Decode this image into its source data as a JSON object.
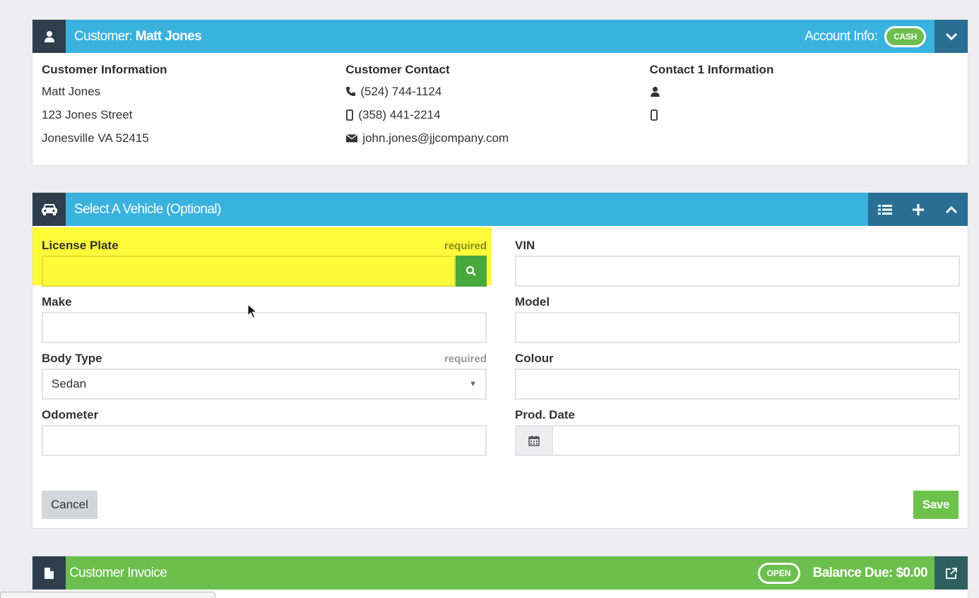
{
  "customer_panel": {
    "title_prefix": "Customer:",
    "customer_name": "Matt Jones",
    "account_info_label": "Account Info:",
    "account_badge": "CASH",
    "columns": {
      "info": {
        "heading": "Customer Information",
        "name": "Matt Jones",
        "street": "123 Jones Street",
        "city_line": "Jonesville VA 52415"
      },
      "contact": {
        "heading": "Customer Contact",
        "phone": "(524) 744-1124",
        "mobile": "(358) 441-2214",
        "email": "john.jones@jjcompany.com"
      },
      "contact1": {
        "heading": "Contact 1 Information"
      }
    }
  },
  "vehicle_panel": {
    "title": "Select A Vehicle (Optional)",
    "fields": {
      "license_plate": {
        "label": "License Plate",
        "required": "required",
        "value": ""
      },
      "vin": {
        "label": "VIN",
        "value": ""
      },
      "make": {
        "label": "Make",
        "value": ""
      },
      "model": {
        "label": "Model",
        "value": ""
      },
      "body_type": {
        "label": "Body Type",
        "required": "required",
        "selected": "Sedan"
      },
      "colour": {
        "label": "Colour",
        "value": ""
      },
      "odometer": {
        "label": "Odometer",
        "value": ""
      },
      "prod_date": {
        "label": "Prod. Date",
        "value": ""
      }
    },
    "cancel_label": "Cancel",
    "save_label": "Save"
  },
  "invoice_panel": {
    "title": "Customer Invoice",
    "status_badge": "OPEN",
    "balance_label": "Balance Due: $0.00"
  },
  "colors": {
    "header_blue": "#3ab2de",
    "header_green": "#6cbf4c",
    "icon_box": "#2f3e4c",
    "highlight": "#fffb3a",
    "save_green": "#6cc24a"
  }
}
